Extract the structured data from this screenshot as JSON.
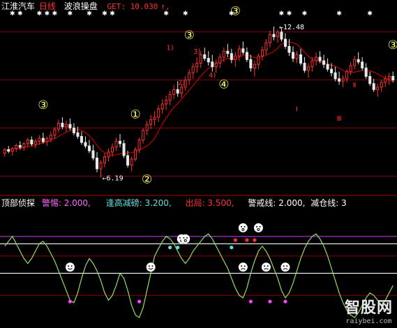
{
  "header": {
    "stock_name": "江淮汽车",
    "period": "日线",
    "indicator": "波浪操盘",
    "get_text": "GET: 10.030",
    "up_arrow": "↑,"
  },
  "lower_header": {
    "name": "顶部侦探",
    "warn_label": "警惕: 2.000,",
    "reduce_label": "逢高减磅: 3.200,",
    "exit_label": "出局: 3.500,",
    "alert_label": "警戒线: 2.000,",
    "cut_label": "减仓线: 3"
  },
  "colors": {
    "bg": "#000000",
    "up": "#ff3030",
    "down": "#e8e8e8",
    "ma": "#c00000",
    "wave_label": "#ffff66",
    "osc": "#8fe060",
    "magenta": "#ff44ff",
    "cyan": "#66dddd",
    "ref_line": "#ffffff",
    "grid": "#8b0000",
    "purple_line": "#a030c0"
  },
  "chart_data": [
    {
      "type": "candlestick",
      "title": "波浪操盘",
      "ylim": [
        5.5,
        13.0
      ],
      "grid": true,
      "gridlines": [
        6.25,
        8.25,
        10.25,
        12.25
      ],
      "candles": [
        [
          7.2,
          7.4,
          7.05,
          7.35
        ],
        [
          7.35,
          7.5,
          7.2,
          7.28
        ],
        [
          7.28,
          7.45,
          7.1,
          7.4
        ],
        [
          7.4,
          7.6,
          7.25,
          7.52
        ],
        [
          7.52,
          7.7,
          7.35,
          7.45
        ],
        [
          7.45,
          7.65,
          7.3,
          7.6
        ],
        [
          7.6,
          7.85,
          7.45,
          7.75
        ],
        [
          7.75,
          7.9,
          7.5,
          7.58
        ],
        [
          7.58,
          7.8,
          7.4,
          7.7
        ],
        [
          7.7,
          7.95,
          7.55,
          7.82
        ],
        [
          7.82,
          8.05,
          7.6,
          7.68
        ],
        [
          7.68,
          7.9,
          7.5,
          7.8
        ],
        [
          7.8,
          8.1,
          7.65,
          7.95
        ],
        [
          7.95,
          8.3,
          7.8,
          8.2
        ],
        [
          8.2,
          8.6,
          8.05,
          8.45
        ],
        [
          8.45,
          8.7,
          8.2,
          8.3
        ],
        [
          8.3,
          8.55,
          8.1,
          8.4
        ],
        [
          8.4,
          8.65,
          8.15,
          8.25
        ],
        [
          8.25,
          8.45,
          7.95,
          8.05
        ],
        [
          8.05,
          8.3,
          7.8,
          7.9
        ],
        [
          7.9,
          8.1,
          7.55,
          7.65
        ],
        [
          7.65,
          7.9,
          7.4,
          7.5
        ],
        [
          7.5,
          7.75,
          7.2,
          7.3
        ],
        [
          7.3,
          7.55,
          6.9,
          7.0
        ],
        [
          7.0,
          7.25,
          6.4,
          6.55
        ],
        [
          6.55,
          6.9,
          6.19,
          6.8
        ],
        [
          6.8,
          7.2,
          6.6,
          7.05
        ],
        [
          7.05,
          7.4,
          6.85,
          7.25
        ],
        [
          7.25,
          7.6,
          7.05,
          7.45
        ],
        [
          7.45,
          7.85,
          7.3,
          7.7
        ],
        [
          7.7,
          8.0,
          7.45,
          7.6
        ],
        [
          7.6,
          7.75,
          7.0,
          7.1
        ],
        [
          7.1,
          7.3,
          6.6,
          6.7
        ],
        [
          6.7,
          7.05,
          6.45,
          6.95
        ],
        [
          6.95,
          7.45,
          6.85,
          7.35
        ],
        [
          7.35,
          7.85,
          7.2,
          7.75
        ],
        [
          7.75,
          8.25,
          7.6,
          8.15
        ],
        [
          8.15,
          8.55,
          7.95,
          8.4
        ],
        [
          8.4,
          8.8,
          8.2,
          8.6
        ],
        [
          8.6,
          8.95,
          8.35,
          8.7
        ],
        [
          8.7,
          9.2,
          8.5,
          9.05
        ],
        [
          9.05,
          9.45,
          8.85,
          9.25
        ],
        [
          9.25,
          9.6,
          9.0,
          9.4
        ],
        [
          9.4,
          9.8,
          9.2,
          9.65
        ],
        [
          9.65,
          10.05,
          9.45,
          9.85
        ],
        [
          9.85,
          10.2,
          9.55,
          9.7
        ],
        [
          9.7,
          10.1,
          9.5,
          9.95
        ],
        [
          9.95,
          10.4,
          9.8,
          10.25
        ],
        [
          10.25,
          10.7,
          10.05,
          10.55
        ],
        [
          10.55,
          10.95,
          10.3,
          10.8
        ],
        [
          10.8,
          11.2,
          10.55,
          10.95
        ],
        [
          10.95,
          11.45,
          10.75,
          11.3
        ],
        [
          11.3,
          11.6,
          11.05,
          11.15
        ],
        [
          11.15,
          11.45,
          10.85,
          11.0
        ],
        [
          11.0,
          11.3,
          10.6,
          10.8
        ],
        [
          10.8,
          11.1,
          10.55,
          10.95
        ],
        [
          10.95,
          11.35,
          10.75,
          11.2
        ],
        [
          11.2,
          11.6,
          11.0,
          11.45
        ],
        [
          11.45,
          11.75,
          11.2,
          11.35
        ],
        [
          11.35,
          11.55,
          10.95,
          11.1
        ],
        [
          11.1,
          11.4,
          10.8,
          11.25
        ],
        [
          11.25,
          11.7,
          11.05,
          11.55
        ],
        [
          11.55,
          11.85,
          11.3,
          11.4
        ],
        [
          11.4,
          11.6,
          11.0,
          11.1
        ],
        [
          11.1,
          11.3,
          10.6,
          10.75
        ],
        [
          10.75,
          11.05,
          10.4,
          10.9
        ],
        [
          10.9,
          11.35,
          10.7,
          11.25
        ],
        [
          11.25,
          11.65,
          11.05,
          11.5
        ],
        [
          11.5,
          11.95,
          11.3,
          11.8
        ],
        [
          11.8,
          12.3,
          11.6,
          12.15
        ],
        [
          12.15,
          12.48,
          11.9,
          12.05
        ],
        [
          12.05,
          12.35,
          11.8,
          12.25
        ],
        [
          12.25,
          12.45,
          11.85,
          11.95
        ],
        [
          11.95,
          12.2,
          11.55,
          11.65
        ],
        [
          11.65,
          11.95,
          11.25,
          11.4
        ],
        [
          11.4,
          11.65,
          11.0,
          11.15
        ],
        [
          11.15,
          11.45,
          10.95,
          11.3
        ],
        [
          11.3,
          11.55,
          10.85,
          10.95
        ],
        [
          10.95,
          11.2,
          10.55,
          10.65
        ],
        [
          10.65,
          10.95,
          10.35,
          10.8
        ],
        [
          10.8,
          11.2,
          10.6,
          11.05
        ],
        [
          11.05,
          11.4,
          10.85,
          11.2
        ],
        [
          11.2,
          11.45,
          10.95,
          11.05
        ],
        [
          11.05,
          11.3,
          10.75,
          10.9
        ],
        [
          10.9,
          11.15,
          10.6,
          10.7
        ],
        [
          10.7,
          10.95,
          10.4,
          10.55
        ],
        [
          10.55,
          10.8,
          10.2,
          10.3
        ],
        [
          10.3,
          10.6,
          10.05,
          10.2
        ],
        [
          10.2,
          10.45,
          9.95,
          10.3
        ],
        [
          10.3,
          10.7,
          10.15,
          10.6
        ],
        [
          10.6,
          11.0,
          10.45,
          10.85
        ],
        [
          10.85,
          11.25,
          10.7,
          11.1
        ],
        [
          11.1,
          11.4,
          10.9,
          11.0
        ],
        [
          11.0,
          11.2,
          10.65,
          10.75
        ],
        [
          10.75,
          10.95,
          10.3,
          10.4
        ],
        [
          10.4,
          10.6,
          10.0,
          10.1
        ],
        [
          10.1,
          10.3,
          9.75,
          9.85
        ],
        [
          9.85,
          10.1,
          9.55,
          9.95
        ],
        [
          9.95,
          10.25,
          9.75,
          10.15
        ],
        [
          10.15,
          10.45,
          9.95,
          10.3
        ],
        [
          10.3,
          10.55,
          10.05,
          10.4
        ],
        [
          10.4,
          10.6,
          10.15,
          10.25
        ]
      ],
      "annotations": [
        {
          "label": "③",
          "color": "#ffff66",
          "index": 10,
          "price": 9.05,
          "pos": "above"
        },
        {
          "label": "①",
          "color": "#ffff66",
          "index": 34,
          "price": 8.65,
          "pos": "above"
        },
        {
          "label": "②",
          "color": "#ffff66",
          "index": 37,
          "price": 5.95,
          "pos": "below"
        },
        {
          "label": "③",
          "color": "#ffff66",
          "index": 48,
          "price": 11.95,
          "pos": "above"
        },
        {
          "label": "③",
          "color": "#ffff66",
          "index": 60,
          "price": 12.95,
          "pos": "above"
        },
        {
          "label": "③",
          "color": "#ffff66",
          "index": 101,
          "price": 11.55,
          "pos": "above"
        },
        {
          "label": "④",
          "color": "#ffff66",
          "index": 57,
          "price": 9.9,
          "pos": "below"
        },
        {
          "label": "1)",
          "color": "#ff3030",
          "index": 43,
          "price": 11.5,
          "pos": "above"
        },
        {
          "label": "3)",
          "color": "#ff3030",
          "index": 50,
          "price": 11.35,
          "pos": "above"
        },
        {
          "label": "2)",
          "color": "#ff3030",
          "index": 46,
          "price": 10.05,
          "pos": "below"
        },
        {
          "label": "4)",
          "color": "#ff3030",
          "index": 54,
          "price": 10.35,
          "pos": "below"
        },
        {
          "label": "Ⅱ",
          "color": "#ff3030",
          "index": 91,
          "price": 9.95,
          "pos": "below"
        },
        {
          "label": "Ⅰ",
          "color": "#ff3030",
          "index": 76,
          "price": 8.95,
          "pos": "below"
        },
        {
          "label": "Ⅲ",
          "color": "#ff3030",
          "index": 87,
          "price": 8.55,
          "pos": "below"
        }
      ],
      "price_labels": [
        {
          "text": "←12.48",
          "index": 71,
          "price": 12.48
        },
        {
          "text": "←6.19",
          "index": 25,
          "price": 6.19
        }
      ]
    },
    {
      "type": "line",
      "title": "顶部侦探",
      "ylim": [
        0.0,
        4.6
      ],
      "grid": true,
      "series": [
        {
          "name": "",
          "values": [
            3.1,
            3.3,
            3.5,
            3.2,
            2.9,
            2.6,
            2.4,
            2.6,
            2.9,
            3.2,
            3.3,
            3.1,
            2.8,
            2.5,
            2.1,
            1.7,
            1.3,
            0.9,
            0.8,
            1.2,
            1.8,
            2.3,
            2.6,
            2.4,
            2.1,
            1.7,
            1.2,
            0.9,
            1.1,
            1.5,
            2.0,
            1.8,
            1.3,
            0.7,
            0.3,
            0.2,
            0.6,
            1.3,
            2.0,
            2.7,
            3.0,
            3.3,
            3.5,
            3.4,
            3.2,
            2.9,
            2.6,
            2.4,
            2.6,
            2.9,
            3.1,
            3.3,
            3.5,
            3.6,
            3.4,
            3.1,
            2.8,
            2.5,
            2.2,
            1.8,
            1.4,
            1.1,
            1.0,
            1.4,
            2.0,
            2.5,
            2.9,
            3.1,
            2.9,
            2.6,
            2.2,
            1.8,
            1.3,
            1.0,
            1.2,
            1.6,
            2.1,
            2.6,
            3.0,
            3.3,
            3.5,
            3.6,
            3.4,
            3.1,
            2.7,
            2.2,
            1.7,
            1.2,
            0.8,
            0.5,
            0.3,
            0.2,
            0.4,
            0.7,
            1.0,
            1.2,
            1.1,
            0.9,
            0.7,
            0.9,
            1.2,
            1.5
          ]
        }
      ],
      "reference_lines": [
        3.5,
        3.2,
        2.0
      ],
      "grid_levels": [
        2.7,
        1.1
      ],
      "markers": [
        {
          "kind": "dot",
          "color": "#ff44ff",
          "index": 17,
          "value": 0.85
        },
        {
          "kind": "dot",
          "color": "#ff44ff",
          "index": 35,
          "value": 0.85
        },
        {
          "kind": "dot",
          "color": "#ff44ff",
          "index": 64,
          "value": 0.85
        },
        {
          "kind": "dot",
          "color": "#ff44ff",
          "index": 69,
          "value": 0.85
        },
        {
          "kind": "dot",
          "color": "#ff44ff",
          "index": 73,
          "value": 0.85
        },
        {
          "kind": "dot",
          "color": "#66dddd",
          "index": 43,
          "value": 3.05
        },
        {
          "kind": "dot",
          "color": "#66dddd",
          "index": 45,
          "value": 3.05
        },
        {
          "kind": "dot",
          "color": "#66dddd",
          "index": 59,
          "value": 3.05
        },
        {
          "kind": "dot",
          "color": "#ff3030",
          "index": 60,
          "value": 3.35
        },
        {
          "kind": "dot",
          "color": "#ff3030",
          "index": 63,
          "value": 3.35
        },
        {
          "kind": "dot",
          "color": "#ff3030",
          "index": 65,
          "value": 3.35
        },
        {
          "kind": "face",
          "mood": "happy",
          "index": 17,
          "value": 2.25
        },
        {
          "kind": "face",
          "mood": "happy",
          "index": 38,
          "value": 2.25
        },
        {
          "kind": "face",
          "mood": "sad",
          "index": 62,
          "value": 2.25
        },
        {
          "kind": "face",
          "mood": "sad",
          "index": 68,
          "value": 2.25
        },
        {
          "kind": "face",
          "mood": "sad",
          "index": 73,
          "value": 2.25
        },
        {
          "kind": "face",
          "mood": "surprised",
          "index": 46,
          "value": 3.4
        },
        {
          "kind": "face",
          "mood": "surprised",
          "index": 47,
          "value": 3.4
        },
        {
          "kind": "face",
          "mood": "surprised",
          "index": 62,
          "value": 3.85
        },
        {
          "kind": "face",
          "mood": "surprised",
          "index": 66,
          "value": 3.85
        }
      ]
    }
  ],
  "watermark": {
    "title": "智股网",
    "url": "raiybei.com"
  }
}
